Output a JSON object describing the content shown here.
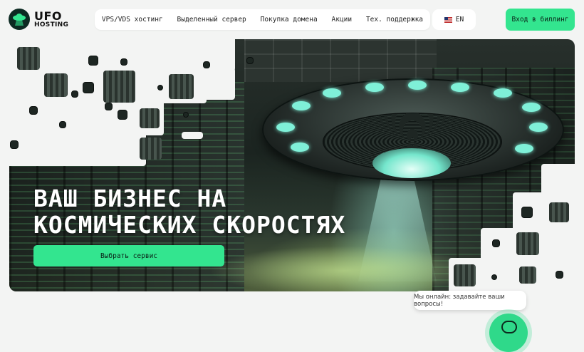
{
  "brand": {
    "name": "UFO",
    "sub": "HOSTING"
  },
  "nav": {
    "items": [
      "VPS/VDS хостинг",
      "Выделенный сервер",
      "Покупка домена",
      "Акции",
      "Тех. поддержка"
    ]
  },
  "lang": {
    "label": "EN"
  },
  "header": {
    "billing_label": "Вход в биллинг"
  },
  "hero": {
    "title_line1": "ВАШ БИЗНЕС НА",
    "title_line2": "КОСМИЧЕСКИХ СКОРОСТЯХ",
    "cta_label": "Выбрать сервис"
  },
  "chat": {
    "bubble_text": "Мы онлайн: задавайте ваши вопросы!"
  },
  "colors": {
    "accent": "#33e58f",
    "dark": "#0c2a22",
    "background": "#f3f4f3"
  }
}
